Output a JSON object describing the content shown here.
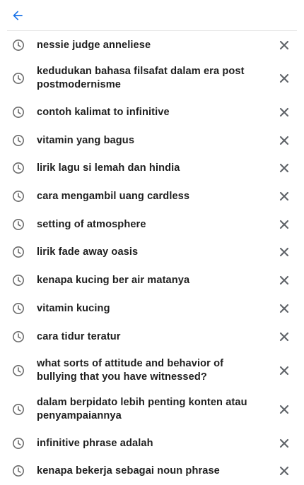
{
  "header": {
    "back_icon": "arrow-left-icon",
    "accent_color": "#1a73e8"
  },
  "history": {
    "item_icon": "clock-icon",
    "remove_icon": "close-icon",
    "items": [
      {
        "label": "nessie judge anneliese"
      },
      {
        "label": "kedudukan bahasa filsafat dalam era post postmodernisme"
      },
      {
        "label": "contoh kalimat to infinitive"
      },
      {
        "label": "vitamin yang bagus"
      },
      {
        "label": "lirik lagu si lemah dan hindia"
      },
      {
        "label": "cara mengambil uang cardless"
      },
      {
        "label": "setting of atmosphere"
      },
      {
        "label": "lirik fade away oasis"
      },
      {
        "label": "kenapa kucing ber air matanya"
      },
      {
        "label": "vitamin kucing"
      },
      {
        "label": "cara tidur teratur"
      },
      {
        "label": "what sorts of attitude and behavior of bullying that you have witnessed?"
      },
      {
        "label": "dalam berpidato lebih penting konten atau penyampaiannya"
      },
      {
        "label": "infinitive phrase adalah"
      },
      {
        "label": "kenapa bekerja sebagai noun phrase"
      }
    ]
  }
}
